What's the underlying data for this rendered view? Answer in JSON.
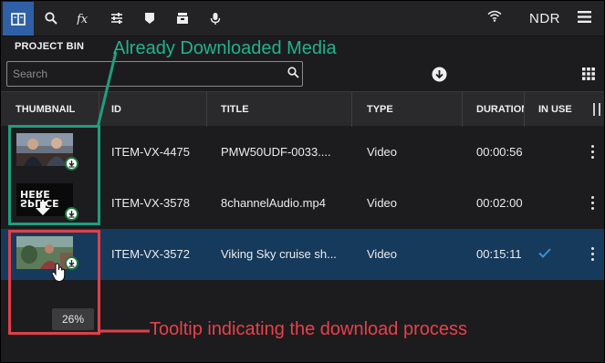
{
  "toolbar": {
    "icons": [
      "bin-icon",
      "search-icon",
      "effects-icon",
      "adjust-icon",
      "marker-icon",
      "archive-icon",
      "microphone-icon"
    ],
    "org": "NDR"
  },
  "bin": {
    "title": "PROJECT BIN",
    "search_placeholder": "Search"
  },
  "table": {
    "headers": [
      "THUMBNAIL",
      "ID",
      "TITLE",
      "TYPE",
      "DURATION",
      "IN USE"
    ],
    "rows": [
      {
        "id": "ITEM-VX-4475",
        "title": "PMW50UDF-0033....",
        "type": "Video",
        "duration": "00:00:56",
        "in_use": false,
        "selected": false
      },
      {
        "id": "ITEM-VX-3578",
        "title": "8channelAudio.mp4",
        "type": "Video",
        "duration": "00:02:00",
        "in_use": false,
        "selected": false
      },
      {
        "id": "ITEM-VX-3572",
        "title": "Viking Sky cruise sh...",
        "type": "Video",
        "duration": "00:15:11",
        "in_use": true,
        "selected": true
      }
    ]
  },
  "tooltip": {
    "progress_text": "26%",
    "progress": 0.26
  },
  "annotations": {
    "downloaded": "Already Downloaded Media",
    "tooltip": "Tooltip indicating the download process"
  },
  "colors": {
    "accent": "#2f5fa7",
    "selected_row": "#163a5c",
    "annotation_green": "#1f9e7e",
    "annotation_red": "#e0404a",
    "download_badge": "#1e7a3c"
  }
}
